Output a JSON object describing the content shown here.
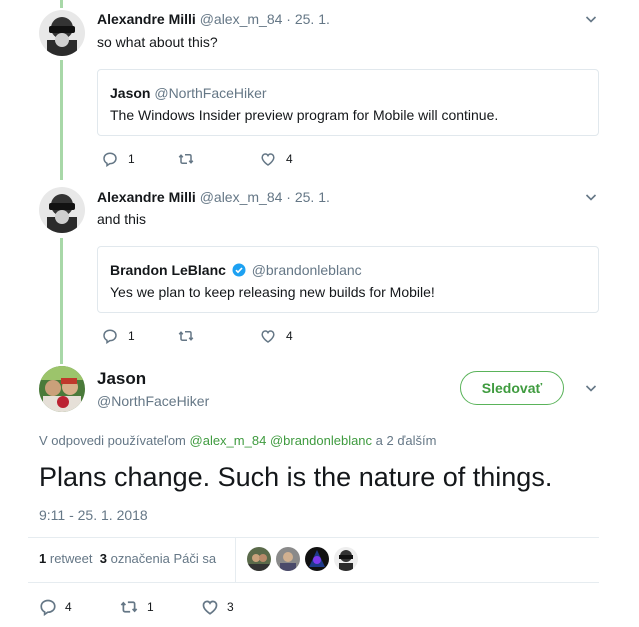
{
  "thread": [
    {
      "author": "Alexandre Milli",
      "handle": "@alex_m_84",
      "date": "· 25. 1.",
      "text": "so what about this?",
      "quote": {
        "author": "Jason",
        "handle": "@NorthFaceHiker",
        "text": "The Windows Insider preview program for Mobile will continue."
      },
      "actions": {
        "replies": "1",
        "retweets": "",
        "likes": "4"
      }
    },
    {
      "author": "Alexandre Milli",
      "handle": "@alex_m_84",
      "date": "· 25. 1.",
      "text": "and this",
      "quote": {
        "author": "Brandon LeBlanc",
        "handle": "@brandonleblanc",
        "text": "Yes we plan to keep releasing new builds for Mobile!"
      },
      "actions": {
        "replies": "1",
        "retweets": "",
        "likes": "4"
      }
    }
  ],
  "main_tweet": {
    "author": "Jason",
    "handle": "@NorthFaceHiker",
    "follow_label": "Sledovať",
    "reply_prefix": "V odpovedi používateľom",
    "reply_user1": "@alex_m_84",
    "reply_user2": "@brandonleblanc",
    "reply_suffix": "a 2 ďalším",
    "text": "Plans change.  Such is the nature of things.",
    "timestamp": "9:11 - 25. 1. 2018",
    "stats": {
      "retweets_count": "1",
      "retweets_label": "retweet",
      "quotes_count": "3",
      "quotes_label": "označenia",
      "likes_label": "Páči sa"
    },
    "actions": {
      "replies": "4",
      "retweets": "1",
      "likes": "3"
    }
  },
  "colors": {
    "accent": "#3f9b3f",
    "secondary_text": "#657786",
    "thread_line": "#a8d8a8"
  }
}
